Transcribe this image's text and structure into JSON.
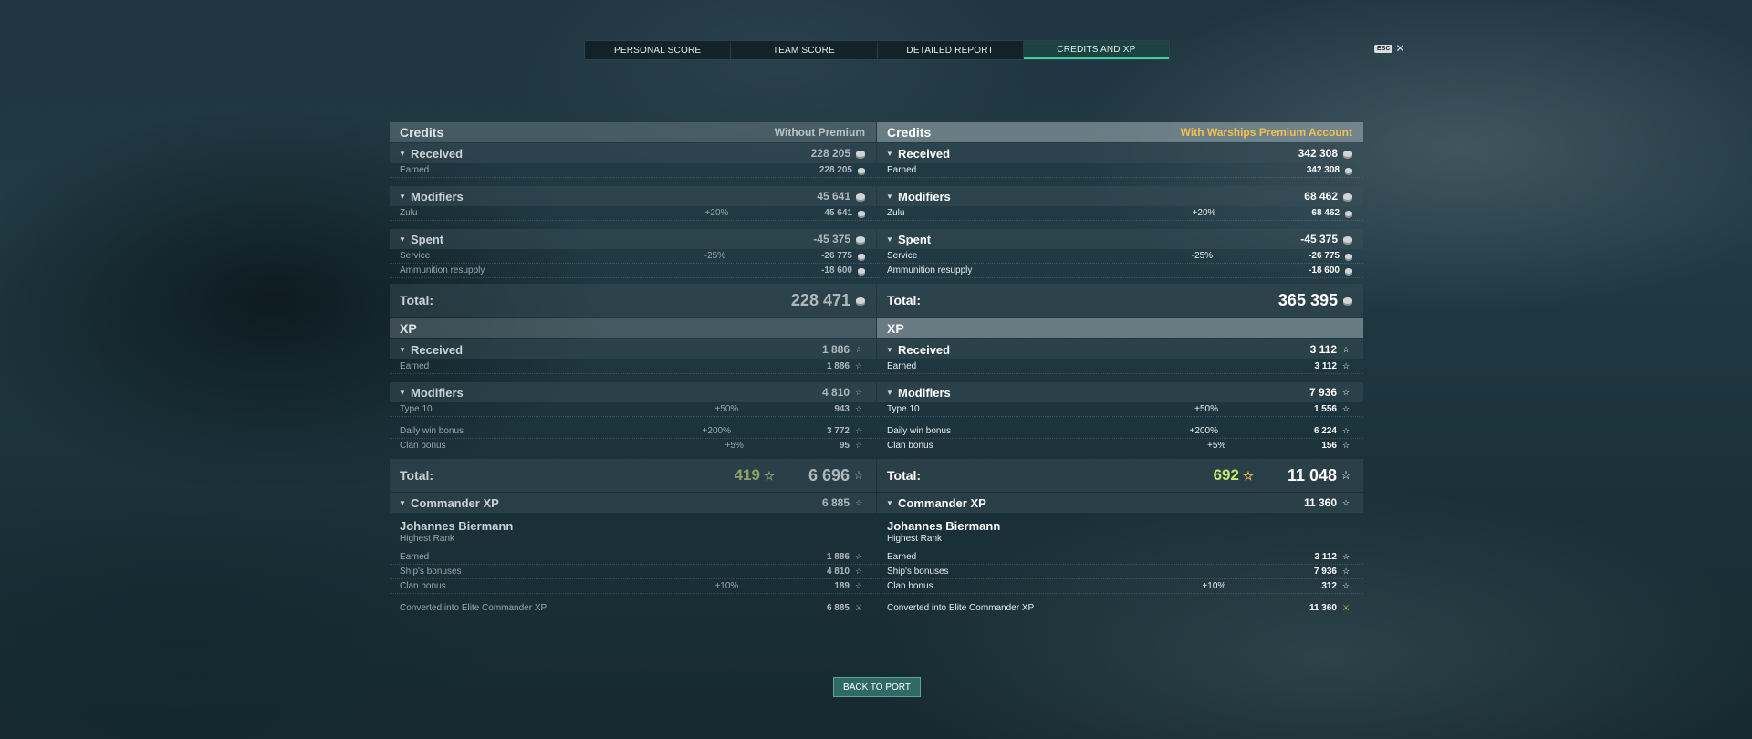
{
  "tabs": [
    {
      "label": "PERSONAL SCORE"
    },
    {
      "label": "TEAM SCORE"
    },
    {
      "label": "DETAILED REPORT"
    },
    {
      "label": "CREDITS AND XP"
    }
  ],
  "esc": {
    "key": "ESC",
    "close": "✕"
  },
  "left": {
    "credits": {
      "title": "Credits",
      "note": "Without Premium",
      "received": {
        "label": "Received",
        "value": "228 205",
        "rows": [
          {
            "name": "Earned",
            "value": "228 205"
          }
        ]
      },
      "modifiers": {
        "label": "Modifiers",
        "value": "45 641",
        "rows": [
          {
            "name": "Zulu",
            "pct": "+20%",
            "value": "45 641"
          }
        ]
      },
      "spent": {
        "label": "Spent",
        "value": "-45 375",
        "rows": [
          {
            "name": "Service",
            "pct": "-25%",
            "value": "-26 775"
          },
          {
            "name": "Ammunition resupply",
            "pct": "",
            "value": "-18 600"
          }
        ]
      },
      "total": {
        "label": "Total:",
        "value": "228 471"
      }
    },
    "xp": {
      "title": "XP",
      "received": {
        "label": "Received",
        "value": "1 886",
        "rows": [
          {
            "name": "Earned",
            "value": "1 886"
          }
        ]
      },
      "modifiers": {
        "label": "Modifiers",
        "value": "4 810",
        "rows": [
          {
            "name": "Type 10",
            "pct": "+50%",
            "value": "943"
          },
          {
            "name": "Daily win bonus",
            "pct": "+200%",
            "value": "3 772"
          },
          {
            "name": "Clan bonus",
            "pct": "+5%",
            "value": "95"
          }
        ]
      },
      "total": {
        "label": "Total:",
        "bonus": "419",
        "value": "6 696"
      }
    },
    "commander": {
      "label": "Commander XP",
      "value": "6 885",
      "name": "Johannes Biermann",
      "rank": "Highest Rank",
      "rows": [
        {
          "name": "Earned",
          "pct": "",
          "value": "1 886"
        },
        {
          "name": "Ship's bonuses",
          "pct": "",
          "value": "4 810"
        },
        {
          "name": "Clan bonus",
          "pct": "+10%",
          "value": "189"
        }
      ],
      "converted": {
        "name": "Converted into Elite Commander XP",
        "value": "6 885"
      }
    }
  },
  "right": {
    "credits": {
      "title": "Credits",
      "note": "With Warships Premium Account",
      "received": {
        "label": "Received",
        "value": "342 308",
        "rows": [
          {
            "name": "Earned",
            "value": "342 308"
          }
        ]
      },
      "modifiers": {
        "label": "Modifiers",
        "value": "68 462",
        "rows": [
          {
            "name": "Zulu",
            "pct": "+20%",
            "value": "68 462"
          }
        ]
      },
      "spent": {
        "label": "Spent",
        "value": "-45 375",
        "rows": [
          {
            "name": "Service",
            "pct": "-25%",
            "value": "-26 775"
          },
          {
            "name": "Ammunition resupply",
            "pct": "",
            "value": "-18 600"
          }
        ]
      },
      "total": {
        "label": "Total:",
        "value": "365 395"
      }
    },
    "xp": {
      "title": "XP",
      "received": {
        "label": "Received",
        "value": "3 112",
        "rows": [
          {
            "name": "Earned",
            "value": "3 112"
          }
        ]
      },
      "modifiers": {
        "label": "Modifiers",
        "value": "7 936",
        "rows": [
          {
            "name": "Type 10",
            "pct": "+50%",
            "value": "1 556"
          },
          {
            "name": "Daily win bonus",
            "pct": "+200%",
            "value": "6 224"
          },
          {
            "name": "Clan bonus",
            "pct": "+5%",
            "value": "156"
          }
        ]
      },
      "total": {
        "label": "Total:",
        "bonus": "692",
        "value": "11 048"
      }
    },
    "commander": {
      "label": "Commander XP",
      "value": "11 360",
      "name": "Johannes Biermann",
      "rank": "Highest Rank",
      "rows": [
        {
          "name": "Earned",
          "pct": "",
          "value": "3 112"
        },
        {
          "name": "Ship's bonuses",
          "pct": "",
          "value": "7 936"
        },
        {
          "name": "Clan bonus",
          "pct": "+10%",
          "value": "312"
        }
      ],
      "converted": {
        "name": "Converted into Elite Commander XP",
        "value": "11 360"
      }
    }
  },
  "back_button": "BACK TO PORT",
  "colors": {
    "accent": "#3fd0a0",
    "premium": "#f2c14e",
    "xp_bonus": "#c6e86a",
    "button": "#2f6a66"
  },
  "icons": {
    "credits": "credits-coin-icon",
    "xp": "xp-star-icon",
    "elite": "elite-xp-icon",
    "arrow": "chevron-down-icon"
  }
}
